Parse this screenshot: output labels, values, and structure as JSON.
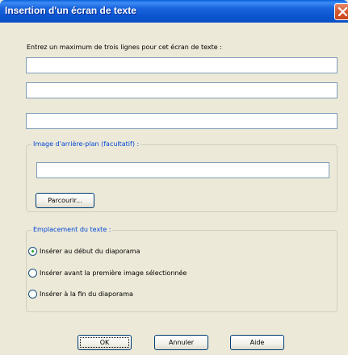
{
  "window": {
    "title": "Insertion d'un écran de texte"
  },
  "text_screen": {
    "prompt": "Entrez un maximum de trois lignes pour cet écran de texte :",
    "line1": "",
    "line2": "",
    "line3": ""
  },
  "background": {
    "group_label": "Image d'arrière-plan (facultatif) :",
    "path_value": "",
    "browse_label": "Parcourir..."
  },
  "placement": {
    "group_label": "Emplacement du texte :",
    "options": [
      {
        "label": "Insérer au début du diaporama",
        "selected": true
      },
      {
        "label": "Insérer avant la première image sélectionnée",
        "selected": false
      },
      {
        "label": "Insérer à la fin du diaporama",
        "selected": false
      }
    ]
  },
  "buttons": {
    "ok": "OK",
    "cancel": "Annuler",
    "help": "Aide"
  }
}
